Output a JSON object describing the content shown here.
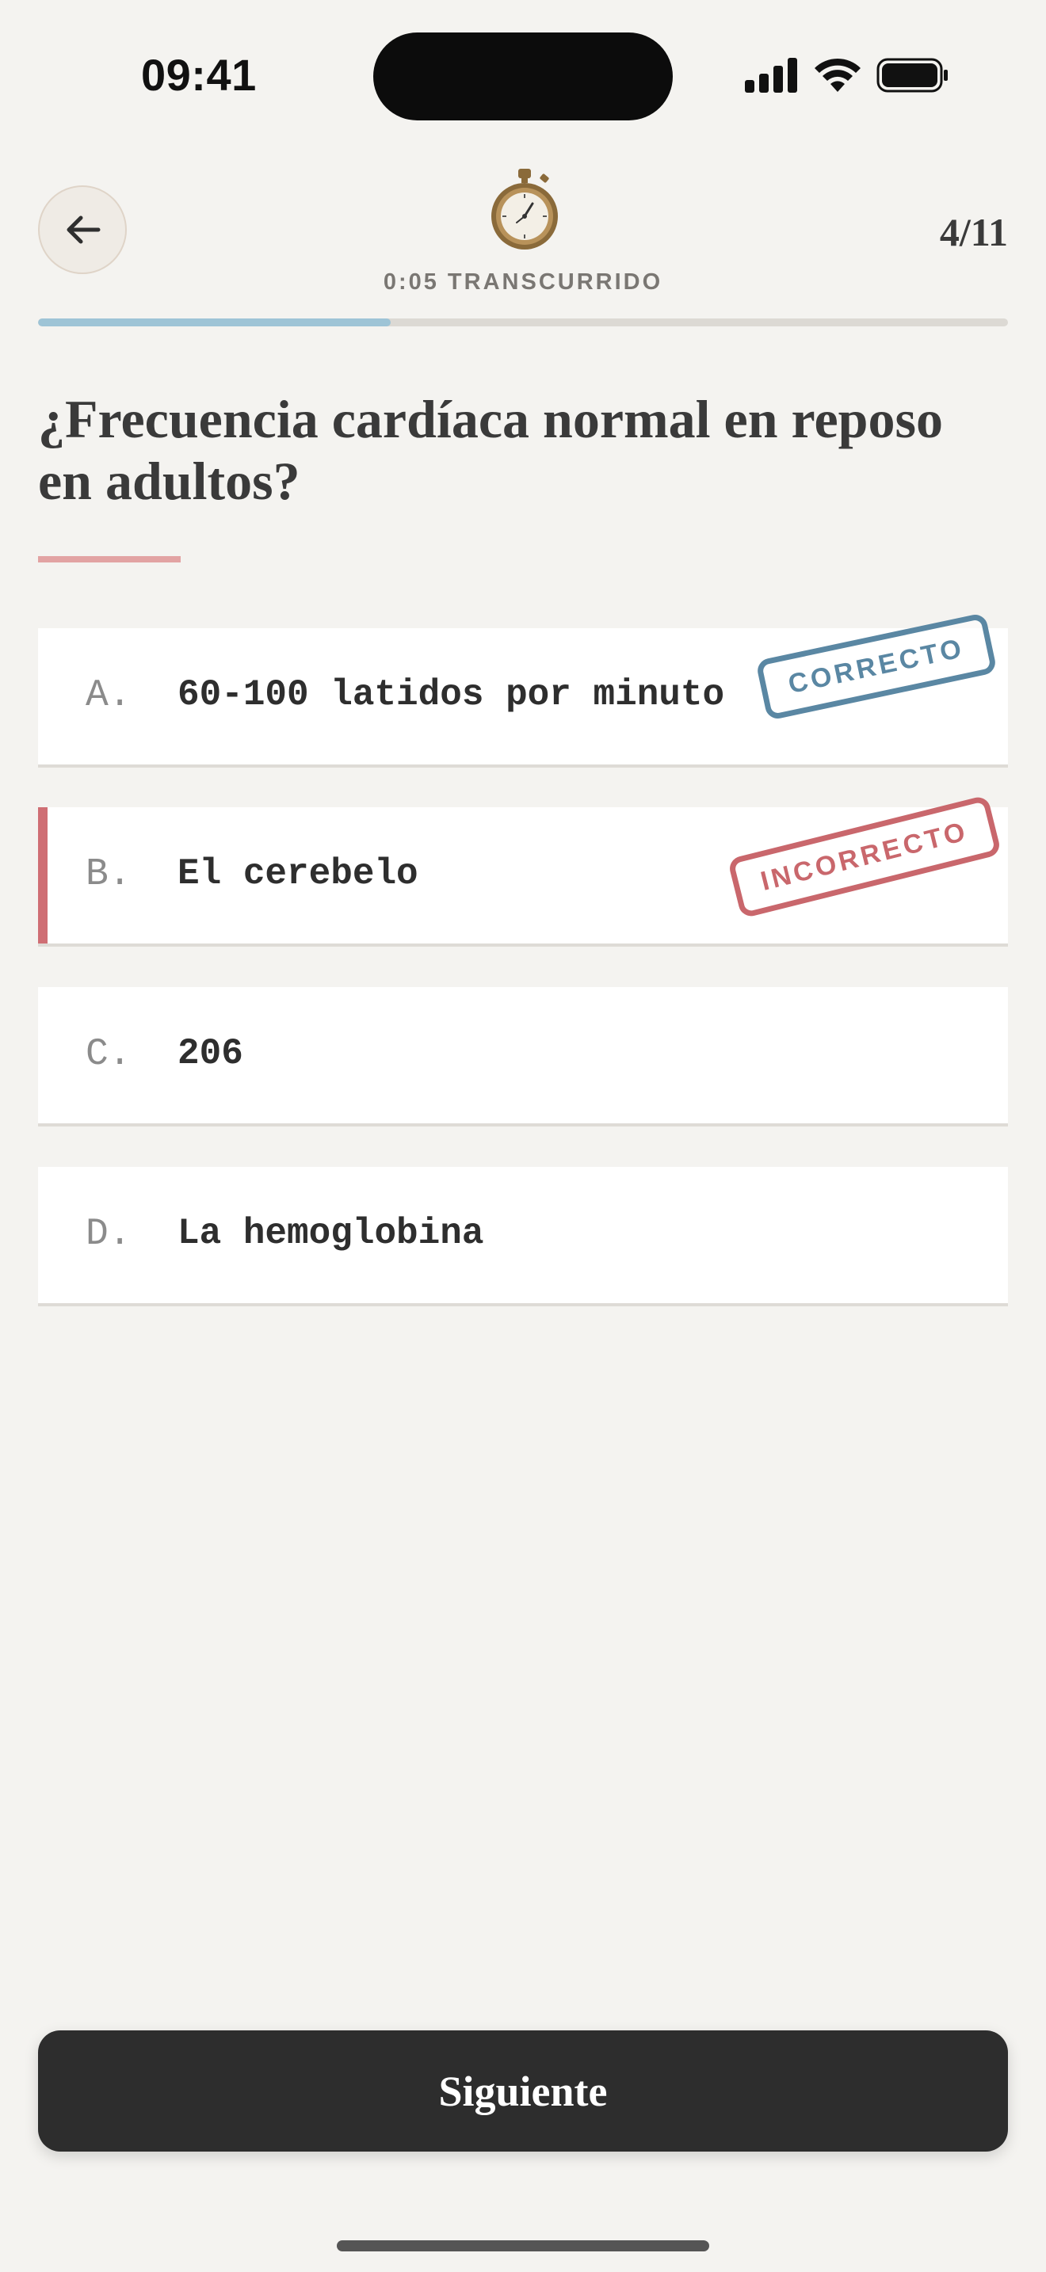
{
  "status_bar": {
    "time": "09:41",
    "icons": [
      "signal-icon",
      "wifi-icon",
      "battery-icon"
    ]
  },
  "header": {
    "back_icon": "arrow-left-icon",
    "timer_icon": "stopwatch-icon",
    "elapsed": "0:05 TRANSCURRIDO",
    "counter": "4/11",
    "progress_fraction": 0.3636
  },
  "question": {
    "text": "¿Frecuencia cardíaca normal en reposo en adultos?"
  },
  "answers": [
    {
      "letter": "A.",
      "text": "60-100 latidos por minuto",
      "stamp": "CORRECTO",
      "state": "correct"
    },
    {
      "letter": "B.",
      "text": "El cerebelo",
      "stamp": "INCORRECTO",
      "state": "incorrect"
    },
    {
      "letter": "C.",
      "text": "206",
      "state": "neutral"
    },
    {
      "letter": "D.",
      "text": "La hemoglobina",
      "state": "neutral"
    }
  ],
  "footer": {
    "next_label": "Siguiente"
  },
  "colors": {
    "background": "#f4f3f0",
    "progress": "#9ec4d6",
    "correct": "#5a87a3",
    "incorrect": "#c9676c",
    "button": "#2d2d2d"
  }
}
